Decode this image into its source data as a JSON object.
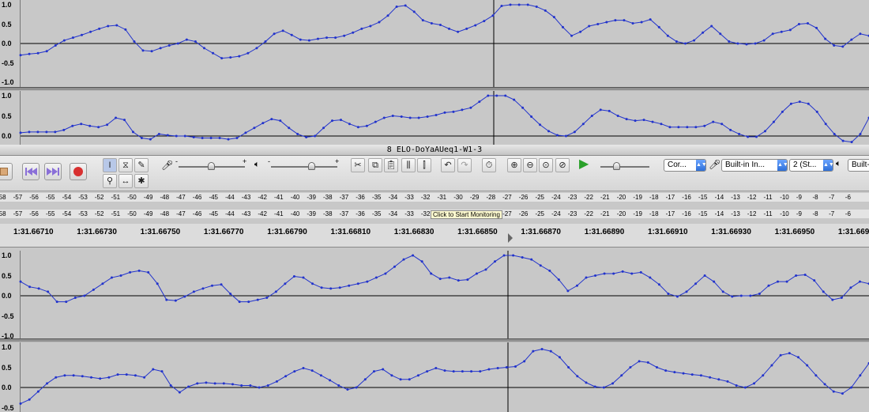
{
  "window_title": "8 ELO-DoYaAUeq1-W1-3",
  "amp_labels": [
    "1.0",
    "0.5",
    "0.0",
    "-0.5",
    "-1.0"
  ],
  "waveform_color": "#2233cc",
  "toolbar": {
    "selection_tool": "selection-tool-icon",
    "input_device": "Built-in In...",
    "output_device": "Built-",
    "host": "Cor...",
    "channels": "2 (St...",
    "mic_slider_plus": "+",
    "mic_slider_minus": "-",
    "play_slider_plus": "+",
    "play_slider_minus": "-"
  },
  "meter_labels": [
    "-58",
    "-57",
    "-56",
    "-55",
    "-54",
    "-53",
    "-52",
    "-51",
    "-50",
    "-49",
    "-48",
    "-47",
    "-46",
    "-45",
    "-44",
    "-43",
    "-42",
    "-41",
    "-40",
    "-39",
    "-38",
    "-37",
    "-36",
    "-35",
    "-34",
    "-33",
    "-32",
    "-31",
    "-30",
    "-29",
    "-28",
    "-27",
    "-26",
    "-25",
    "-24",
    "-23",
    "-22",
    "-21",
    "-20",
    "-19",
    "-18",
    "-17",
    "-16",
    "-15",
    "-14",
    "-13",
    "-12",
    "-11",
    "-10",
    "-9",
    "-8",
    "-7",
    "-6"
  ],
  "meter_tooltip": "Click to Start Monitoring",
  "timeline_labels": [
    "1:31.66710",
    "1:31.66730",
    "1:31.66750",
    "1:31.66770",
    "1:31.66790",
    "1:31.66810",
    "1:31.66830",
    "1:31.66850",
    "1:31.66870",
    "1:31.66890",
    "1:31.66910",
    "1:31.66930",
    "1:31.66950",
    "1:31.6697"
  ],
  "tracks": [
    {
      "name": "top-left-channel",
      "values": [
        -0.3,
        -0.27,
        -0.25,
        -0.2,
        -0.05,
        0.08,
        0.15,
        0.22,
        0.3,
        0.38,
        0.45,
        0.47,
        0.36,
        0.05,
        -0.18,
        -0.2,
        -0.12,
        -0.05,
        0.0,
        0.1,
        0.05,
        -0.12,
        -0.25,
        -0.38,
        -0.36,
        -0.33,
        -0.25,
        -0.12,
        0.05,
        0.25,
        0.33,
        0.22,
        0.1,
        0.08,
        0.12,
        0.15,
        0.15,
        0.2,
        0.28,
        0.38,
        0.45,
        0.55,
        0.72,
        0.95,
        0.98,
        0.82,
        0.6,
        0.52,
        0.48,
        0.38,
        0.3,
        0.38,
        0.47,
        0.58,
        0.72,
        0.97,
        1.0,
        1.0,
        1.0,
        0.95,
        0.85,
        0.68,
        0.42,
        0.2,
        0.3,
        0.45,
        0.5,
        0.55,
        0.6,
        0.6,
        0.52,
        0.55,
        0.62,
        0.42,
        0.2,
        0.05,
        0.0,
        0.08,
        0.28,
        0.45,
        0.25,
        0.05,
        0.0,
        -0.02,
        0.0,
        0.08,
        0.25,
        0.3,
        0.35,
        0.5,
        0.52,
        0.4,
        0.12,
        -0.05,
        -0.08,
        0.1,
        0.25,
        0.2
      ]
    },
    {
      "name": "top-right-channel",
      "values": [
        0.08,
        0.1,
        0.1,
        0.1,
        0.1,
        0.15,
        0.25,
        0.3,
        0.25,
        0.22,
        0.28,
        0.45,
        0.4,
        0.1,
        -0.05,
        -0.08,
        0.05,
        0.02,
        0.0,
        0.0,
        -0.03,
        -0.05,
        -0.05,
        -0.05,
        -0.08,
        -0.05,
        0.08,
        0.2,
        0.32,
        0.42,
        0.38,
        0.2,
        0.05,
        -0.03,
        0.0,
        0.2,
        0.38,
        0.4,
        0.3,
        0.22,
        0.25,
        0.35,
        0.45,
        0.5,
        0.48,
        0.45,
        0.45,
        0.48,
        0.52,
        0.58,
        0.6,
        0.65,
        0.7,
        0.85,
        1.0,
        1.0,
        1.0,
        0.9,
        0.7,
        0.48,
        0.28,
        0.12,
        0.02,
        0.0,
        0.1,
        0.3,
        0.5,
        0.65,
        0.62,
        0.5,
        0.42,
        0.38,
        0.4,
        0.35,
        0.3,
        0.22,
        0.22,
        0.22,
        0.22,
        0.25,
        0.35,
        0.3,
        0.15,
        0.05,
        -0.02,
        -0.02,
        0.12,
        0.35,
        0.6,
        0.8,
        0.85,
        0.8,
        0.6,
        0.3,
        0.05,
        -0.12,
        -0.15,
        0.05,
        0.45
      ]
    },
    {
      "name": "bottom-left-channel",
      "values": [
        0.35,
        0.22,
        0.18,
        0.1,
        -0.15,
        -0.15,
        -0.05,
        0.0,
        0.15,
        0.3,
        0.45,
        0.5,
        0.58,
        0.62,
        0.58,
        0.3,
        -0.1,
        -0.12,
        -0.02,
        0.1,
        0.18,
        0.25,
        0.28,
        0.05,
        -0.15,
        -0.15,
        -0.1,
        -0.05,
        0.1,
        0.3,
        0.48,
        0.45,
        0.3,
        0.2,
        0.18,
        0.2,
        0.25,
        0.3,
        0.35,
        0.45,
        0.55,
        0.72,
        0.9,
        1.0,
        0.85,
        0.55,
        0.42,
        0.45,
        0.38,
        0.4,
        0.55,
        0.65,
        0.85,
        1.0,
        1.0,
        0.95,
        0.9,
        0.75,
        0.62,
        0.4,
        0.12,
        0.25,
        0.45,
        0.5,
        0.55,
        0.55,
        0.6,
        0.55,
        0.58,
        0.45,
        0.28,
        0.05,
        -0.02,
        0.1,
        0.3,
        0.5,
        0.35,
        0.1,
        -0.02,
        0.0,
        0.0,
        0.05,
        0.25,
        0.35,
        0.35,
        0.5,
        0.52,
        0.38,
        0.1,
        -0.1,
        -0.05,
        0.2,
        0.35,
        0.3
      ]
    },
    {
      "name": "bottom-right-channel",
      "values": [
        -0.4,
        -0.3,
        -0.1,
        0.1,
        0.25,
        0.3,
        0.3,
        0.28,
        0.25,
        0.22,
        0.25,
        0.32,
        0.32,
        0.3,
        0.25,
        0.45,
        0.4,
        0.05,
        -0.12,
        0.02,
        0.1,
        0.12,
        0.1,
        0.1,
        0.08,
        0.05,
        0.05,
        0.0,
        0.05,
        0.15,
        0.28,
        0.4,
        0.48,
        0.42,
        0.3,
        0.18,
        0.05,
        -0.05,
        0.0,
        0.2,
        0.4,
        0.45,
        0.3,
        0.2,
        0.2,
        0.3,
        0.4,
        0.48,
        0.42,
        0.4,
        0.4,
        0.4,
        0.4,
        0.45,
        0.48,
        0.5,
        0.52,
        0.65,
        0.9,
        0.95,
        0.9,
        0.75,
        0.5,
        0.28,
        0.12,
        0.02,
        0.0,
        0.1,
        0.3,
        0.5,
        0.65,
        0.62,
        0.5,
        0.42,
        0.38,
        0.35,
        0.32,
        0.3,
        0.25,
        0.2,
        0.15,
        0.05,
        0.0,
        0.1,
        0.3,
        0.55,
        0.8,
        0.85,
        0.75,
        0.55,
        0.3,
        0.08,
        -0.1,
        -0.15,
        0.0,
        0.3,
        0.6
      ]
    }
  ]
}
